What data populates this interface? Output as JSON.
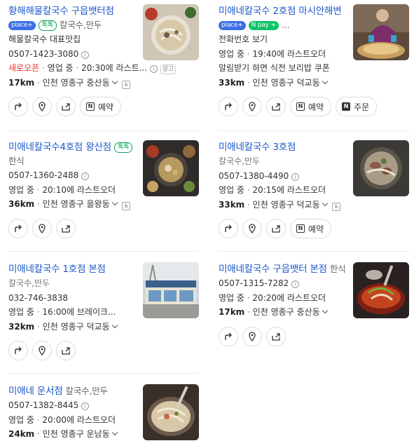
{
  "cards": [
    {
      "title": "황해해물칼국수 구읍뱃터점",
      "tags": [
        "place+",
        "톡톡"
      ],
      "category": "칼국수,만두",
      "extra_line": "해물칼국수 대표맛집",
      "phone": "0507-1423-3080",
      "status_new": "새로오픈",
      "status": "영업 중",
      "hours": "20:30에 라스트...",
      "ad": "광고",
      "distance": "17km",
      "address": "인천 영종구 중산동",
      "actions": [
        "directions",
        "map",
        "share",
        "예약"
      ]
    },
    {
      "title": "미애네칼국수 2호점 마시안해변",
      "tags": [
        "place+",
        "pay"
      ],
      "extra_line": "전화번호 보기",
      "status": "영업 중",
      "hours": "19:40에 라스트오더",
      "coupon": "알림받기 하면 식전 보리밥 쿠폰",
      "distance": "33km",
      "address": "인천 영종구 덕교동",
      "actions": [
        "directions",
        "map",
        "share",
        "예약",
        "주문"
      ]
    },
    {
      "title": "미애네칼국수4호점 왕산점",
      "tags": [
        "톡톡"
      ],
      "category": "한식",
      "phone": "0507-1360-2488",
      "status": "영업 중",
      "hours": "20:10에 라스트오더",
      "distance": "36km",
      "address": "인천 영종구 을왕동",
      "actions": [
        "directions",
        "map",
        "share"
      ]
    },
    {
      "title": "미애네칼국수 3호점",
      "category": "칼국수,만두",
      "phone": "0507-1380-4490",
      "status": "영업 중",
      "hours": "20:15에 라스트오더",
      "distance": "33km",
      "address": "인천 영종구 덕교동",
      "actions": [
        "directions",
        "map",
        "share",
        "예약"
      ]
    },
    {
      "title": "미애네칼국수 1호점 본점",
      "category": "칼국수,만두",
      "phone": "032-746-3838",
      "status": "영업 중",
      "hours": "16:00에 브레이크...",
      "distance": "32km",
      "address": "인천 영종구 덕교동",
      "actions": [
        "directions",
        "map",
        "share"
      ]
    },
    {
      "title": "미애네칼국수 구읍뱃터 본점",
      "category": "한식",
      "phone": "0507-1315-7282",
      "status": "영업 중",
      "hours": "20:20에 라스트오더",
      "distance": "17km",
      "address": "인천 영종구 중산동",
      "actions": [
        "directions",
        "map",
        "share"
      ]
    },
    {
      "title": "미애네 운서점",
      "category": "칼국수,만두",
      "phone": "0507-1382-8445",
      "status": "영업 중",
      "hours": "20:00에 라스트오더",
      "distance": "24km",
      "address": "인천 영종구 운남동"
    }
  ],
  "labels": {
    "place_plus": "place+",
    "talk": "톡톡",
    "npay": "pay",
    "reserve": "예약",
    "order": "주문",
    "ad": "광고"
  },
  "colors": {
    "link": "#1b57c8",
    "new": "#e8322b",
    "place": "#3b6fe4",
    "talk": "#11a45a"
  }
}
